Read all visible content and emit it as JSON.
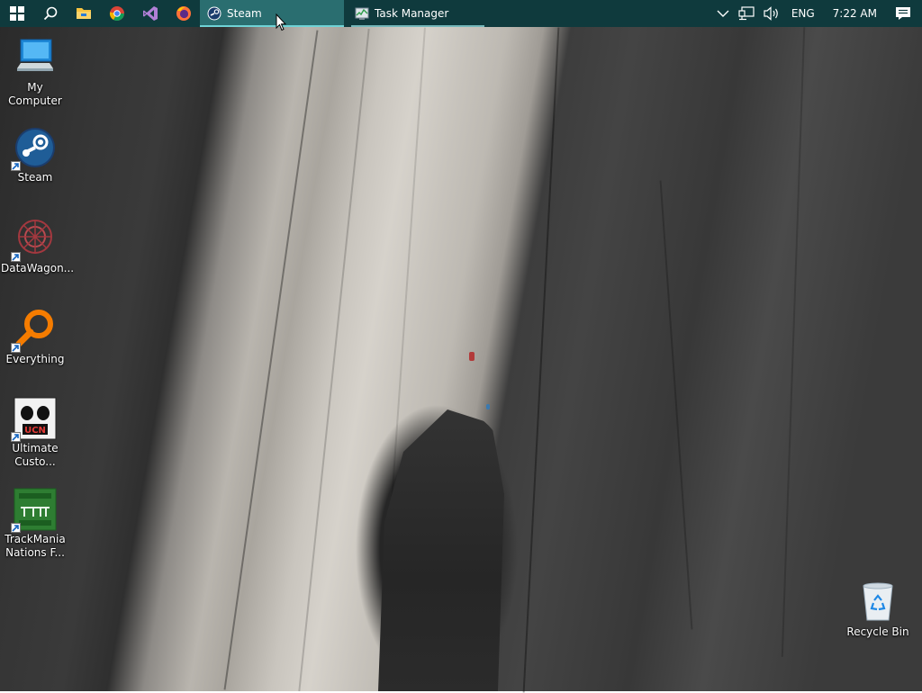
{
  "taskbar": {
    "pinned": [
      {
        "name": "start-icon"
      },
      {
        "name": "search-icon"
      },
      {
        "name": "file-explorer-icon"
      },
      {
        "name": "chrome-icon"
      },
      {
        "name": "visual-studio-icon"
      },
      {
        "name": "firefox-icon"
      }
    ],
    "tasks": [
      {
        "label": "Steam",
        "icon": "steam-icon",
        "state": "active"
      },
      {
        "label": "Task Manager",
        "icon": "task-manager-icon",
        "state": "open"
      }
    ],
    "tray": {
      "language": "ENG",
      "time": "7:22 AM"
    },
    "colors": {
      "bar": "#0f3a3d",
      "active_task": "#2a6e70",
      "underline": "#6fd3d6"
    }
  },
  "desktop": {
    "icons": [
      {
        "label": "My Computer",
        "icon": "computer-icon",
        "shortcut": false
      },
      {
        "label": "Steam",
        "icon": "steam-icon",
        "shortcut": true
      },
      {
        "label": "DataWagon...",
        "icon": "datawagon-icon",
        "shortcut": true
      },
      {
        "label": "Everything",
        "icon": "everything-search-icon",
        "shortcut": true
      },
      {
        "label": "Ultimate Custo...",
        "icon": "ultimate-custom-night-icon",
        "shortcut": true
      },
      {
        "label": "TrackMania Nations F...",
        "icon": "trackmania-icon",
        "shortcut": true
      },
      {
        "label": "Recycle Bin",
        "icon": "recycle-bin-icon",
        "shortcut": false
      }
    ]
  }
}
